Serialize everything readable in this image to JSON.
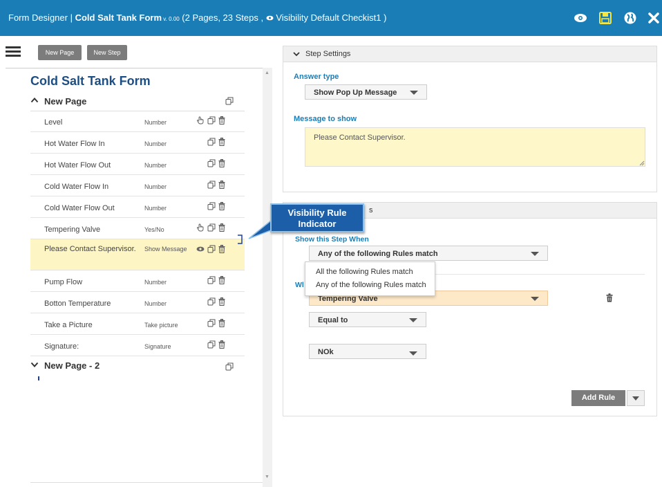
{
  "header": {
    "app_title": "Form Designer | ",
    "form_name": "Cold Salt Tank Form",
    "version": " v. 0.00",
    "summary": " (2 Pages, 23 Steps , ",
    "visibility_label": " Visibility Default Checkist1 )",
    "icons": [
      "eye-icon",
      "save-icon",
      "globe-icon",
      "close-icon"
    ]
  },
  "toolbar": {
    "new_page": "New Page",
    "new_step": "New Step"
  },
  "form": {
    "title": "Cold Salt Tank Form",
    "pages": [
      {
        "label": "New Page",
        "expanded": true
      },
      {
        "label": "New Page - 2",
        "expanded": false
      }
    ],
    "steps": [
      {
        "name": "Level",
        "type": "Number",
        "has_rule_icon": true,
        "has_visibility_icon": false
      },
      {
        "name": "Hot Water Flow In",
        "type": "Number",
        "has_rule_icon": false,
        "has_visibility_icon": false
      },
      {
        "name": "Hot Water Flow Out",
        "type": "Number",
        "has_rule_icon": false,
        "has_visibility_icon": false
      },
      {
        "name": "Cold Water Flow In",
        "type": "Number",
        "has_rule_icon": false,
        "has_visibility_icon": false
      },
      {
        "name": "Cold Water Flow Out",
        "type": "Number",
        "has_rule_icon": false,
        "has_visibility_icon": false
      },
      {
        "name": "Tempering Valve",
        "type": "Yes/No",
        "has_rule_icon": true,
        "has_visibility_icon": false
      },
      {
        "name": "Please Contact Supervisor.",
        "type": "Show Message",
        "has_rule_icon": false,
        "has_visibility_icon": true,
        "selected": true
      },
      {
        "name": "Pump Flow",
        "type": "Number",
        "has_rule_icon": false,
        "has_visibility_icon": false
      },
      {
        "name": "Botton Temperature",
        "type": "Number",
        "has_rule_icon": false,
        "has_visibility_icon": false
      },
      {
        "name": "Take a Picture",
        "type": "Take picture",
        "has_rule_icon": false,
        "has_visibility_icon": false
      },
      {
        "name": "Signature:",
        "type": "Signature",
        "has_rule_icon": false,
        "has_visibility_icon": false
      }
    ]
  },
  "step_settings": {
    "header": "Step Settings",
    "answer_type_label": "Answer type",
    "answer_type_value": "Show Pop Up Message",
    "message_label": "Message to show",
    "message_value": "Please Contact Supervisor."
  },
  "visibility": {
    "header_partial": "s",
    "show_when_label": "Show this Step When",
    "match_value": "Any of the following Rules match",
    "match_options": [
      "All the following Rules match",
      "Any of the following Rules match"
    ],
    "when_partial": "Wl",
    "rule_step": "Tempering Valve",
    "rule_operator": "Equal to",
    "rule_value": "NOk",
    "add_rule": "Add Rule"
  },
  "callout": {
    "line1": "Visibility Rule",
    "line2": "Indicator"
  },
  "colors": {
    "header_bg": "#1a7db5",
    "accent": "#1a7db5",
    "title": "#1c4e84",
    "selected_row": "#fdf5c4",
    "callout": "#1c5fa8",
    "save_icon": "#f5e642"
  }
}
